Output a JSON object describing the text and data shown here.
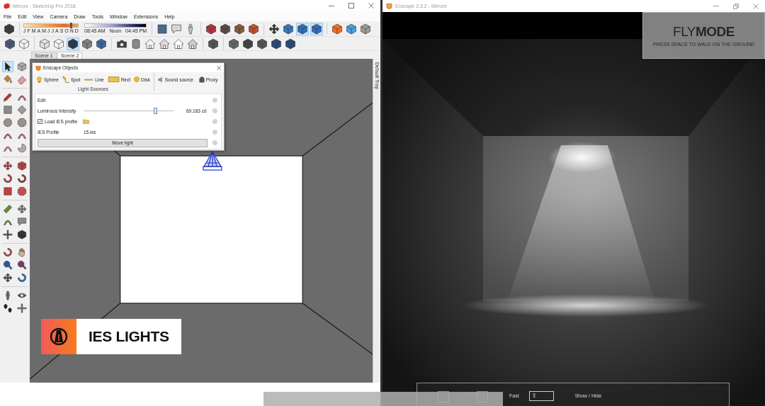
{
  "sketchup": {
    "title": "Mirrors - SketchUp Pro 2018",
    "menu": [
      "File",
      "Edit",
      "View",
      "Camera",
      "Draw",
      "Tools",
      "Window",
      "Extensions",
      "Help"
    ],
    "toolbar_1": [
      {
        "selected": false
      },
      {
        "selected": false
      },
      {
        "selected": false
      },
      {
        "selected": false
      },
      {
        "selected": false
      },
      {
        "selected": false
      },
      {
        "selected": false
      },
      {
        "selected": false
      },
      {
        "selected": false
      },
      {
        "selected": false
      },
      {
        "selected": true
      },
      {
        "selected": true
      },
      {
        "selected": false
      },
      {
        "selected": false
      },
      {
        "selected": false
      }
    ],
    "shadow_date": {
      "level": 0.87
    },
    "shadow_months": [
      "J",
      "F",
      "M",
      "A",
      "M",
      "J",
      "J",
      "A",
      "S",
      "O",
      "N",
      "D"
    ],
    "shadow_times": [
      "08:45 AM",
      "Noon",
      "04:45 PM"
    ],
    "toolbar_2": [
      {
        "selected": false
      },
      {
        "selected": false
      },
      {
        "selected": false
      },
      {
        "selected": false
      },
      {
        "selected": true
      },
      {
        "selected": false
      },
      {
        "selected": false
      },
      {
        "selected": false
      },
      {
        "selected": false
      },
      {
        "selected": false
      },
      {
        "selected": false
      },
      {
        "selected": false
      },
      {
        "selected": false
      },
      {
        "selected": false
      },
      {
        "selected": false
      },
      {
        "selected": false
      },
      {
        "selected": false
      },
      {
        "selected": false
      },
      {
        "selected": false
      }
    ],
    "scene_tabs": [
      {
        "label": "Scene 1",
        "selected": false
      },
      {
        "label": "Scene 2",
        "selected": true
      }
    ],
    "tool_palette": [
      {
        "selected": true
      },
      {
        "selected": false
      },
      {
        "selected": false
      },
      {
        "selected": false
      },
      {
        "selected": false
      },
      {
        "selected": false
      },
      {
        "selected": false
      },
      {
        "selected": false
      },
      {
        "selected": false
      },
      {
        "selected": false
      },
      {
        "selected": false
      },
      {
        "selected": false
      },
      {
        "selected": false
      },
      {
        "selected": false
      },
      {
        "selected": false
      },
      {
        "selected": false
      },
      {
        "selected": false
      },
      {
        "selected": false
      },
      {
        "selected": false
      },
      {
        "selected": false
      },
      {
        "selected": false
      },
      {
        "selected": false
      },
      {
        "selected": false
      },
      {
        "selected": false
      },
      {
        "selected": false
      },
      {
        "selected": false
      },
      {
        "selected": false
      },
      {
        "selected": false
      },
      {
        "selected": false
      },
      {
        "selected": false
      },
      {
        "selected": false
      },
      {
        "selected": false
      },
      {
        "selected": false
      },
      {
        "selected": false
      },
      {
        "selected": false
      },
      {
        "selected": false
      }
    ],
    "tray_tab": "Default Tray"
  },
  "enscape_objects": {
    "title": "Enscape Objects",
    "light_types": [
      "Sphere",
      "Spot",
      "Line",
      "Rect",
      "Disk"
    ],
    "light_group_label": "Light Sources",
    "other_types": [
      "Sound source",
      "Proxy"
    ],
    "rows": [
      {
        "kind": "header",
        "label": "Edit"
      },
      {
        "kind": "slider",
        "label": "Luminous Intensity",
        "level": 0.8,
        "reading": "69.183 cd"
      },
      {
        "kind": "checkbox",
        "label": "Load IES profile",
        "checked": true
      },
      {
        "kind": "value",
        "label": "IES Profile",
        "value": "15.ies"
      },
      {
        "kind": "button",
        "label": "Move light"
      }
    ]
  },
  "banner": {
    "label": "IES LIGHTS"
  },
  "enscape": {
    "title": "Enscape 2.3.2 - Mirrors",
    "mode_title": "FLY**MODE**",
    "mode_hint": "PRESS SPACE TO WALK ON THE GROUND",
    "controls": [
      {
        "label": "Fast",
        "key": "⇧"
      },
      {
        "label": "Show / Hide"
      }
    ]
  }
}
